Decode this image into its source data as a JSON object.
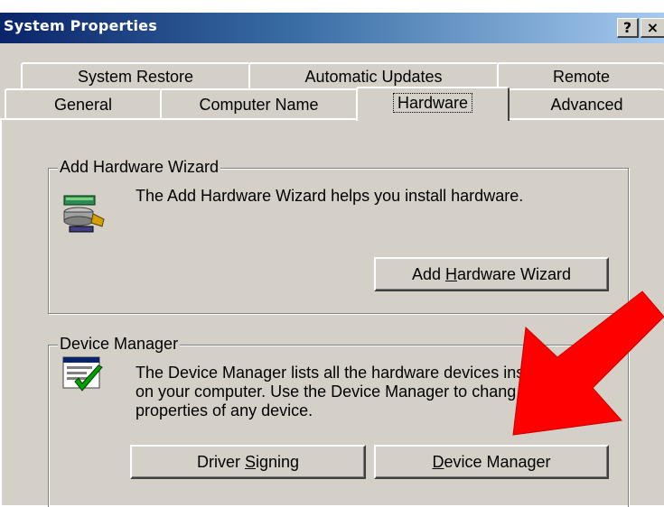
{
  "window": {
    "title": "System Properties",
    "help_label": "?",
    "close_label": "×"
  },
  "tabs": {
    "row1": [
      "System Restore",
      "Automatic Updates",
      "Remote"
    ],
    "row2": [
      "General",
      "Computer Name",
      "Hardware",
      "Advanced"
    ],
    "active": "Hardware"
  },
  "add_hardware": {
    "group_title": "Add Hardware Wizard",
    "description": "The Add Hardware Wizard helps you install hardware.",
    "button": {
      "before": "Add ",
      "mnemonic": "H",
      "after": "ardware Wizard"
    },
    "icon": "hardware-wizard-icon"
  },
  "device_manager": {
    "group_title": "Device Manager",
    "description_lines": [
      "The Device Manager lists all the hardware devices inst",
      "on your computer. Use the Device Manager to chang",
      "properties of any device."
    ],
    "driver_button": {
      "before": "Driver ",
      "mnemonic": "S",
      "after": "igning"
    },
    "dm_button": {
      "before": "",
      "mnemonic": "D",
      "after": "evice Manager"
    },
    "icon": "device-manager-icon"
  },
  "annotation": {
    "icon": "red-arrow-icon",
    "color": "#ff0000"
  },
  "colors": {
    "face": "#d4d0c8",
    "title_start": "#0a246a",
    "title_end": "#a6caf0"
  }
}
